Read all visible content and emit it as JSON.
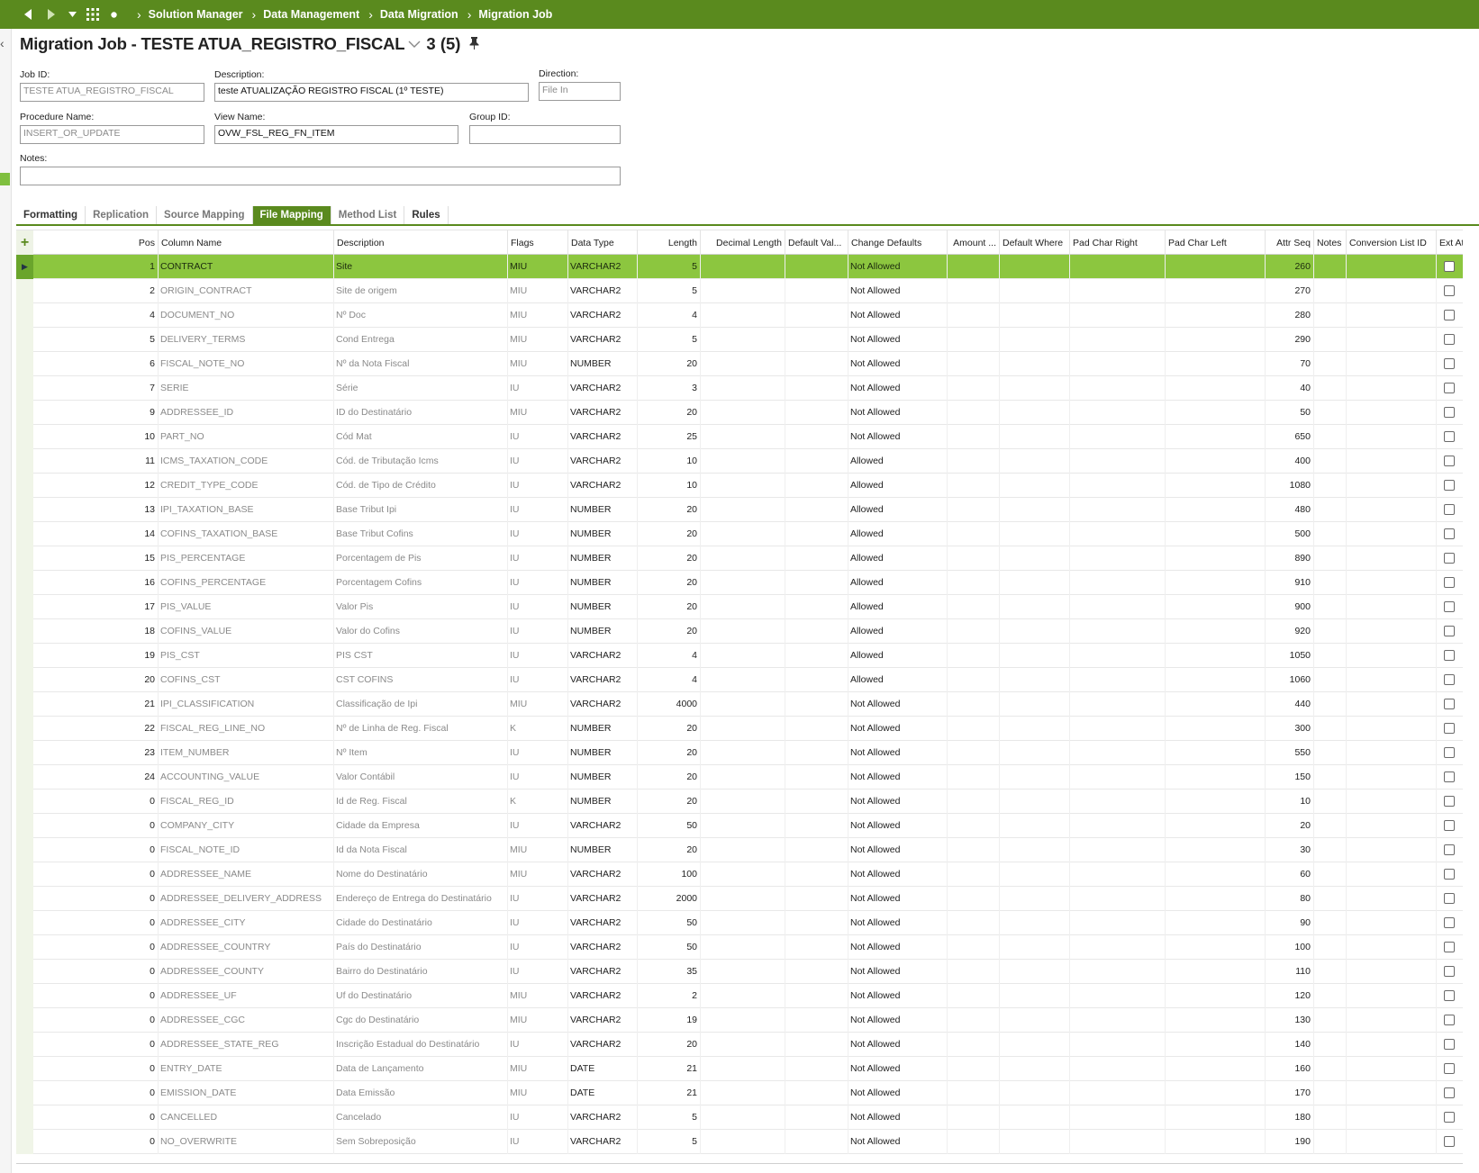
{
  "nav": {
    "breadcrumbs": [
      "Solution Manager",
      "Data Management",
      "Data Migration",
      "Migration Job"
    ]
  },
  "page": {
    "title": "Migration Job - TESTE ATUA_REGISTRO_FISCAL",
    "record_count": "3 (5)"
  },
  "form": {
    "job_id": {
      "label": "Job ID:",
      "value": "TESTE ATUA_REGISTRO_FISCAL"
    },
    "description": {
      "label": "Description:",
      "value": "teste ATUALIZAÇÃO REGISTRO FISCAL (1º TESTE)"
    },
    "direction": {
      "label": "Direction:",
      "value": "File In"
    },
    "procedure_name": {
      "label": "Procedure Name:",
      "value": "INSERT_OR_UPDATE"
    },
    "view_name": {
      "label": "View Name:",
      "value": "OVW_FSL_REG_FN_ITEM"
    },
    "group_id": {
      "label": "Group ID:",
      "value": ""
    },
    "notes": {
      "label": "Notes:",
      "value": ""
    }
  },
  "tabs": [
    "Formatting",
    "Replication",
    "Source Mapping",
    "File Mapping",
    "Method List",
    "Rules"
  ],
  "active_tab": "File Mapping",
  "colors": {
    "accent": "#5a8a1e",
    "selected_row": "#8cc63f"
  },
  "grid": {
    "headers": {
      "pos": "Pos",
      "column_name": "Column Name",
      "description": "Description",
      "flags": "Flags",
      "data_type": "Data Type",
      "length": "Length",
      "decimal_length": "Decimal Length",
      "default_value": "Default Val...",
      "change_defaults": "Change Defaults",
      "amount": "Amount ...",
      "default_where": "Default Where",
      "pad_char_right": "Pad Char Right",
      "pad_char_left": "Pad Char Left",
      "attr_seq": "Attr Seq",
      "notes": "Notes",
      "conversion_list_id": "Conversion List ID",
      "ext_attr": "Ext Attr"
    },
    "rows": [
      {
        "pos": "1",
        "column_name": "CONTRACT",
        "description": "Site",
        "flags": "MIU",
        "data_type": "VARCHAR2",
        "length": "5",
        "change_defaults": "Not Allowed",
        "attr_seq": "260",
        "ext_attr": false
      },
      {
        "pos": "2",
        "column_name": "ORIGIN_CONTRACT",
        "description": "Site de origem",
        "flags": "MIU",
        "data_type": "VARCHAR2",
        "length": "5",
        "change_defaults": "Not Allowed",
        "attr_seq": "270",
        "ext_attr": false
      },
      {
        "pos": "4",
        "column_name": "DOCUMENT_NO",
        "description": "Nº Doc",
        "flags": "MIU",
        "data_type": "VARCHAR2",
        "length": "4",
        "change_defaults": "Not Allowed",
        "attr_seq": "280",
        "ext_attr": false
      },
      {
        "pos": "5",
        "column_name": "DELIVERY_TERMS",
        "description": "Cond Entrega",
        "flags": "MIU",
        "data_type": "VARCHAR2",
        "length": "5",
        "change_defaults": "Not Allowed",
        "attr_seq": "290",
        "ext_attr": false
      },
      {
        "pos": "6",
        "column_name": "FISCAL_NOTE_NO",
        "description": "Nº da Nota Fiscal",
        "flags": "MIU",
        "data_type": "NUMBER",
        "length": "20",
        "change_defaults": "Not Allowed",
        "attr_seq": "70",
        "ext_attr": false
      },
      {
        "pos": "7",
        "column_name": "SERIE",
        "description": "Série",
        "flags": "IU",
        "data_type": "VARCHAR2",
        "length": "3",
        "change_defaults": "Not Allowed",
        "attr_seq": "40",
        "ext_attr": false
      },
      {
        "pos": "9",
        "column_name": "ADDRESSEE_ID",
        "description": "ID do Destinatário",
        "flags": "MIU",
        "data_type": "VARCHAR2",
        "length": "20",
        "change_defaults": "Not Allowed",
        "attr_seq": "50",
        "ext_attr": false
      },
      {
        "pos": "10",
        "column_name": "PART_NO",
        "description": "Cód Mat",
        "flags": "IU",
        "data_type": "VARCHAR2",
        "length": "25",
        "change_defaults": "Not Allowed",
        "attr_seq": "650",
        "ext_attr": false
      },
      {
        "pos": "11",
        "column_name": "ICMS_TAXATION_CODE",
        "description": "Cód. de Tributação Icms",
        "flags": "IU",
        "data_type": "VARCHAR2",
        "length": "10",
        "change_defaults": "Allowed",
        "attr_seq": "400",
        "ext_attr": false
      },
      {
        "pos": "12",
        "column_name": "CREDIT_TYPE_CODE",
        "description": "Cód. de Tipo de Crédito",
        "flags": "IU",
        "data_type": "VARCHAR2",
        "length": "10",
        "change_defaults": "Allowed",
        "attr_seq": "1080",
        "ext_attr": false
      },
      {
        "pos": "13",
        "column_name": "IPI_TAXATION_BASE",
        "description": "Base Tribut Ipi",
        "flags": "IU",
        "data_type": "NUMBER",
        "length": "20",
        "change_defaults": "Allowed",
        "attr_seq": "480",
        "ext_attr": false
      },
      {
        "pos": "14",
        "column_name": "COFINS_TAXATION_BASE",
        "description": "Base Tribut Cofins",
        "flags": "IU",
        "data_type": "NUMBER",
        "length": "20",
        "change_defaults": "Allowed",
        "attr_seq": "500",
        "ext_attr": false
      },
      {
        "pos": "15",
        "column_name": "PIS_PERCENTAGE",
        "description": "Porcentagem de Pis",
        "flags": "IU",
        "data_type": "NUMBER",
        "length": "20",
        "change_defaults": "Allowed",
        "attr_seq": "890",
        "ext_attr": false
      },
      {
        "pos": "16",
        "column_name": "COFINS_PERCENTAGE",
        "description": "Porcentagem Cofins",
        "flags": "IU",
        "data_type": "NUMBER",
        "length": "20",
        "change_defaults": "Allowed",
        "attr_seq": "910",
        "ext_attr": false
      },
      {
        "pos": "17",
        "column_name": "PIS_VALUE",
        "description": "Valor Pis",
        "flags": "IU",
        "data_type": "NUMBER",
        "length": "20",
        "change_defaults": "Allowed",
        "attr_seq": "900",
        "ext_attr": false
      },
      {
        "pos": "18",
        "column_name": "COFINS_VALUE",
        "description": "Valor do Cofins",
        "flags": "IU",
        "data_type": "NUMBER",
        "length": "20",
        "change_defaults": "Allowed",
        "attr_seq": "920",
        "ext_attr": false
      },
      {
        "pos": "19",
        "column_name": "PIS_CST",
        "description": "PIS CST",
        "flags": "IU",
        "data_type": "VARCHAR2",
        "length": "4",
        "change_defaults": "Allowed",
        "attr_seq": "1050",
        "ext_attr": false
      },
      {
        "pos": "20",
        "column_name": "COFINS_CST",
        "description": "CST COFINS",
        "flags": "IU",
        "data_type": "VARCHAR2",
        "length": "4",
        "change_defaults": "Allowed",
        "attr_seq": "1060",
        "ext_attr": false
      },
      {
        "pos": "21",
        "column_name": "IPI_CLASSIFICATION",
        "description": "Classificação de Ipi",
        "flags": "MIU",
        "data_type": "VARCHAR2",
        "length": "4000",
        "change_defaults": "Not Allowed",
        "attr_seq": "440",
        "ext_attr": false
      },
      {
        "pos": "22",
        "column_name": "FISCAL_REG_LINE_NO",
        "description": "Nº de Linha de Reg. Fiscal",
        "flags": "K",
        "data_type": "NUMBER",
        "length": "20",
        "change_defaults": "Not Allowed",
        "attr_seq": "300",
        "ext_attr": false
      },
      {
        "pos": "23",
        "column_name": "ITEM_NUMBER",
        "description": "Nº Item",
        "flags": "IU",
        "data_type": "NUMBER",
        "length": "20",
        "change_defaults": "Not Allowed",
        "attr_seq": "550",
        "ext_attr": false
      },
      {
        "pos": "24",
        "column_name": "ACCOUNTING_VALUE",
        "description": "Valor Contábil",
        "flags": "IU",
        "data_type": "NUMBER",
        "length": "20",
        "change_defaults": "Not Allowed",
        "attr_seq": "150",
        "ext_attr": false
      },
      {
        "pos": "0",
        "column_name": "FISCAL_REG_ID",
        "description": "Id de Reg. Fiscal",
        "flags": "K",
        "data_type": "NUMBER",
        "length": "20",
        "change_defaults": "Not Allowed",
        "attr_seq": "10",
        "ext_attr": false
      },
      {
        "pos": "0",
        "column_name": "COMPANY_CITY",
        "description": "Cidade da Empresa",
        "flags": "IU",
        "data_type": "VARCHAR2",
        "length": "50",
        "change_defaults": "Not Allowed",
        "attr_seq": "20",
        "ext_attr": false
      },
      {
        "pos": "0",
        "column_name": "FISCAL_NOTE_ID",
        "description": "Id da Nota Fiscal",
        "flags": "MIU",
        "data_type": "NUMBER",
        "length": "20",
        "change_defaults": "Not Allowed",
        "attr_seq": "30",
        "ext_attr": false
      },
      {
        "pos": "0",
        "column_name": "ADDRESSEE_NAME",
        "description": "Nome do Destinatário",
        "flags": "MIU",
        "data_type": "VARCHAR2",
        "length": "100",
        "change_defaults": "Not Allowed",
        "attr_seq": "60",
        "ext_attr": false
      },
      {
        "pos": "0",
        "column_name": "ADDRESSEE_DELIVERY_ADDRESS",
        "description": "Endereço de Entrega do Destinatário",
        "flags": "IU",
        "data_type": "VARCHAR2",
        "length": "2000",
        "change_defaults": "Not Allowed",
        "attr_seq": "80",
        "ext_attr": false
      },
      {
        "pos": "0",
        "column_name": "ADDRESSEE_CITY",
        "description": "Cidade do Destinatário",
        "flags": "IU",
        "data_type": "VARCHAR2",
        "length": "50",
        "change_defaults": "Not Allowed",
        "attr_seq": "90",
        "ext_attr": false
      },
      {
        "pos": "0",
        "column_name": "ADDRESSEE_COUNTRY",
        "description": "País do Destinatário",
        "flags": "IU",
        "data_type": "VARCHAR2",
        "length": "50",
        "change_defaults": "Not Allowed",
        "attr_seq": "100",
        "ext_attr": false
      },
      {
        "pos": "0",
        "column_name": "ADDRESSEE_COUNTY",
        "description": "Bairro do Destinatário",
        "flags": "IU",
        "data_type": "VARCHAR2",
        "length": "35",
        "change_defaults": "Not Allowed",
        "attr_seq": "110",
        "ext_attr": false
      },
      {
        "pos": "0",
        "column_name": "ADDRESSEE_UF",
        "description": "Uf do Destinatário",
        "flags": "MIU",
        "data_type": "VARCHAR2",
        "length": "2",
        "change_defaults": "Not Allowed",
        "attr_seq": "120",
        "ext_attr": false
      },
      {
        "pos": "0",
        "column_name": "ADDRESSEE_CGC",
        "description": "Cgc do Destinatário",
        "flags": "MIU",
        "data_type": "VARCHAR2",
        "length": "19",
        "change_defaults": "Not Allowed",
        "attr_seq": "130",
        "ext_attr": false
      },
      {
        "pos": "0",
        "column_name": "ADDRESSEE_STATE_REG",
        "description": "Inscrição Estadual do Destinatário",
        "flags": "IU",
        "data_type": "VARCHAR2",
        "length": "20",
        "change_defaults": "Not Allowed",
        "attr_seq": "140",
        "ext_attr": false
      },
      {
        "pos": "0",
        "column_name": "ENTRY_DATE",
        "description": "Data de Lançamento",
        "flags": "MIU",
        "data_type": "DATE",
        "length": "21",
        "change_defaults": "Not Allowed",
        "attr_seq": "160",
        "ext_attr": false
      },
      {
        "pos": "0",
        "column_name": "EMISSION_DATE",
        "description": "Data Emissão",
        "flags": "MIU",
        "data_type": "DATE",
        "length": "21",
        "change_defaults": "Not Allowed",
        "attr_seq": "170",
        "ext_attr": false
      },
      {
        "pos": "0",
        "column_name": "CANCELLED",
        "description": "Cancelado",
        "flags": "IU",
        "data_type": "VARCHAR2",
        "length": "5",
        "change_defaults": "Not Allowed",
        "attr_seq": "180",
        "ext_attr": false
      },
      {
        "pos": "0",
        "column_name": "NO_OVERWRITE",
        "description": "Sem Sobreposição",
        "flags": "IU",
        "data_type": "VARCHAR2",
        "length": "5",
        "change_defaults": "Not Allowed",
        "attr_seq": "190",
        "ext_attr": false
      }
    ]
  }
}
